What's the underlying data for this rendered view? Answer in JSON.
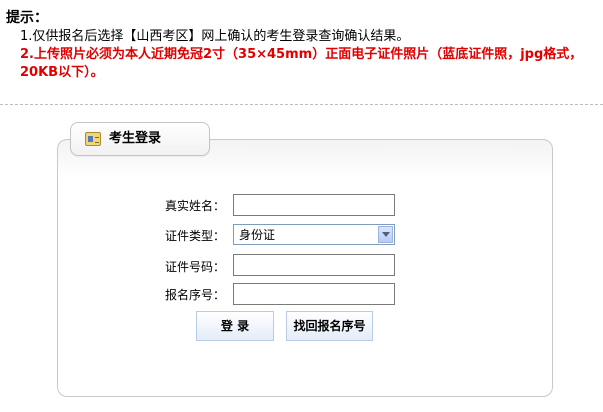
{
  "notice": {
    "title": "提示：",
    "line1": "1.仅供报名后选择【山西考区】网上确认的考生登录查询确认结果。",
    "line2": "2.上传照片必须为本人近期免冠2寸（35×45mm）正面电子证件照片（蓝底证件照，jpg格式，20KB以下）。"
  },
  "panel": {
    "title": "考生登录",
    "icon": "id-card-icon"
  },
  "form": {
    "name_label": "真实姓名：",
    "name_value": "",
    "id_type_label": "证件类型：",
    "id_type_selected": "身份证",
    "id_number_label": "证件号码：",
    "id_number_value": "",
    "reg_number_label": "报名序号：",
    "reg_number_value": ""
  },
  "buttons": {
    "login": "登 录",
    "recover": "找回报名序号"
  },
  "colors": {
    "warning": "#e00000",
    "button_border": "#b9cbe6"
  }
}
